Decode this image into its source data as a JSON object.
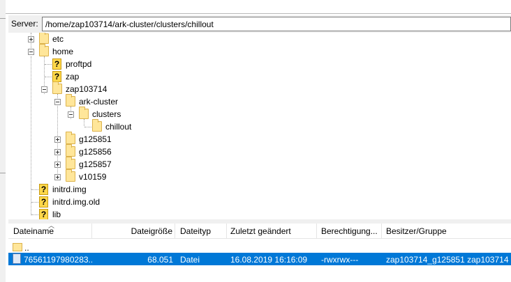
{
  "server": {
    "label": "Server:",
    "path": "/home/zap103714/ark-cluster/clusters/chillout"
  },
  "tree": {
    "items": [
      {
        "label": "etc",
        "icon": "folder-icon",
        "expander": "plus"
      },
      {
        "label": "home",
        "icon": "folder-icon",
        "expander": "minus"
      },
      {
        "label": "proftpd",
        "icon": "unknown-folder-icon",
        "expander": "none"
      },
      {
        "label": "zap",
        "icon": "unknown-folder-icon",
        "expander": "none"
      },
      {
        "label": "zap103714",
        "icon": "folder-icon",
        "expander": "minus"
      },
      {
        "label": "ark-cluster",
        "icon": "folder-icon",
        "expander": "minus"
      },
      {
        "label": "clusters",
        "icon": "folder-icon",
        "expander": "minus"
      },
      {
        "label": "chillout",
        "icon": "folder-icon",
        "expander": "none",
        "selected": true
      },
      {
        "label": "g125851",
        "icon": "folder-icon",
        "expander": "plus"
      },
      {
        "label": "g125856",
        "icon": "folder-icon",
        "expander": "plus"
      },
      {
        "label": "g125857",
        "icon": "folder-icon",
        "expander": "plus"
      },
      {
        "label": "v10159",
        "icon": "folder-icon",
        "expander": "plus"
      },
      {
        "label": "initrd.img",
        "icon": "unknown-folder-icon",
        "expander": "none"
      },
      {
        "label": "initrd.img.old",
        "icon": "unknown-folder-icon",
        "expander": "none"
      },
      {
        "label": "lib",
        "icon": "unknown-folder-icon",
        "expander": "none"
      }
    ]
  },
  "list": {
    "columns": {
      "name": "Dateiname",
      "size": "Dateigröße",
      "type": "Dateityp",
      "modified": "Zuletzt geändert",
      "permissions": "Berechtigung...",
      "owner": "Besitzer/Gruppe"
    },
    "rows": [
      {
        "name": "..",
        "size": "",
        "type": "",
        "modified": "",
        "permissions": "",
        "owner": "",
        "icon": "parent-folder-icon"
      },
      {
        "name": "76561197980283...",
        "size": "68.051",
        "type": "Datei",
        "modified": "16.08.2019 16:16:09",
        "permissions": "-rwxrwx---",
        "owner": "zap103714_g125851 zap103714",
        "icon": "file-icon",
        "selected": true
      }
    ]
  },
  "colors": {
    "selection": "#0078d7",
    "folder": "#ffe69a",
    "unknown": "#ffd84a",
    "panel": "#f0f0f0"
  }
}
